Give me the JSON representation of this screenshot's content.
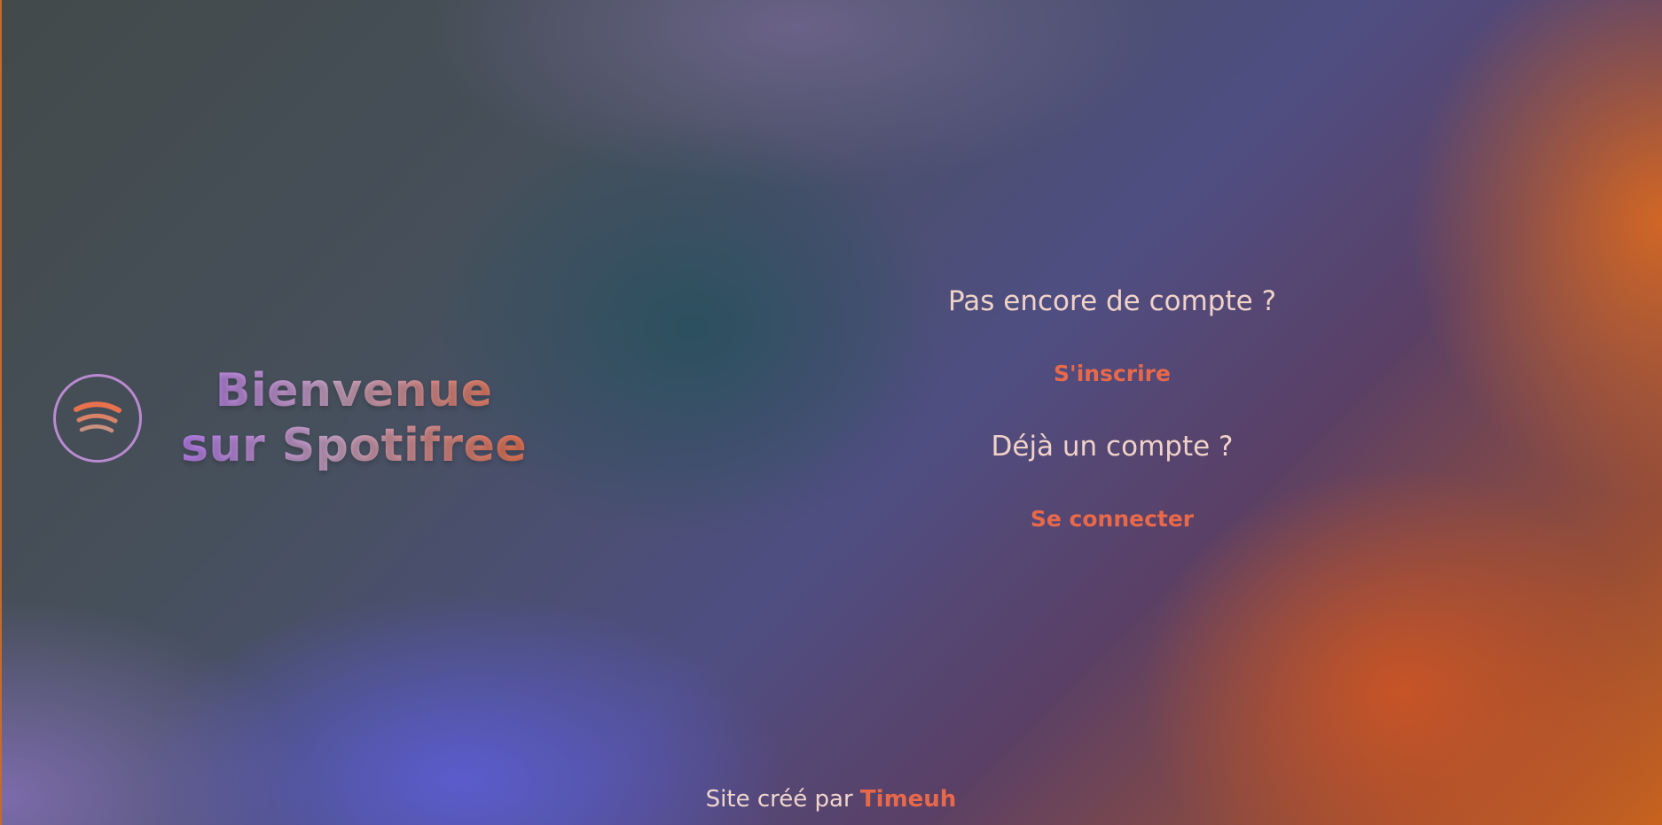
{
  "hero": {
    "title_line1": "Bienvenue",
    "title_line2": "sur Spotifree",
    "logo_icon": "spotify-wave-icon"
  },
  "auth": {
    "signup_question": "Pas encore de compte ?",
    "signup_label": "S'inscrire",
    "login_question": "Déjà un compte ?",
    "login_label": "Se connecter"
  },
  "footer": {
    "prefix": "Site créé par",
    "author": "Timeuh"
  },
  "colors": {
    "accent": "#e8694a",
    "text_light": "#f0d2c8",
    "logo_ring": "#b98ad0"
  }
}
